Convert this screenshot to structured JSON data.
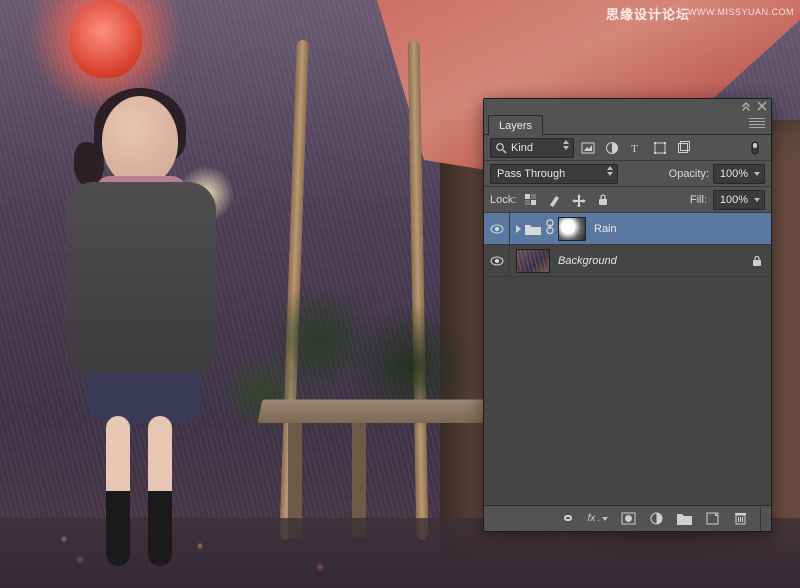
{
  "watermark": {
    "cn": "思缘设计论坛",
    "en": "WWW.MISSYUAN.COM"
  },
  "panel": {
    "title": "Layers",
    "filter": {
      "search_placeholder": "Kind",
      "value": "Kind",
      "filters": [
        "image",
        "adjustment",
        "type",
        "shape",
        "smartobject"
      ]
    },
    "blend": {
      "mode": "Pass Through",
      "opacity_label": "Opacity:",
      "opacity": "100%"
    },
    "lock": {
      "label": "Lock:",
      "fill_label": "Fill:",
      "fill": "100%"
    },
    "layers": [
      {
        "name": "Rain",
        "type": "group",
        "visible": true,
        "selected": true,
        "hasMask": true,
        "locked": false,
        "italic": false
      },
      {
        "name": "Background",
        "type": "layer",
        "visible": true,
        "selected": false,
        "hasMask": false,
        "locked": true,
        "italic": true
      }
    ],
    "footer_buttons": [
      "link",
      "fx",
      "mask",
      "adjust",
      "group",
      "new",
      "trash"
    ]
  }
}
